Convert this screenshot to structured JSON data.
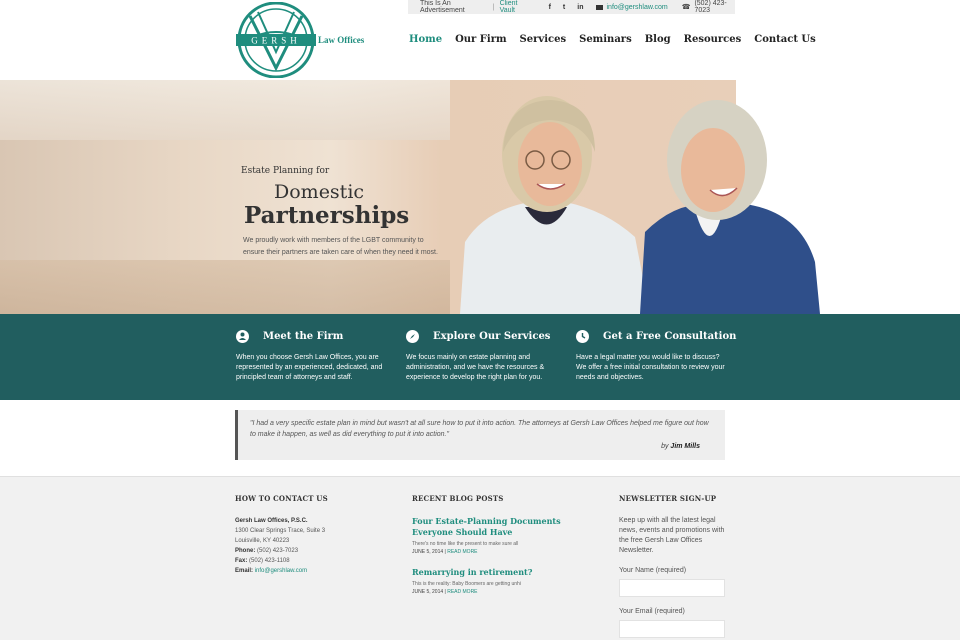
{
  "topbar": {
    "advertisement": "This Is An Advertisement",
    "separator": "|",
    "client_vault": "Client Vault",
    "social": [
      "f",
      "t",
      "in"
    ],
    "email": "info@gershlaw.com",
    "phone": "(502) 423-7023"
  },
  "logo": {
    "name": "GERSH",
    "tagline": "Law Offices"
  },
  "nav": [
    "Home",
    "Our Firm",
    "Services",
    "Seminars",
    "Blog",
    "Resources",
    "Contact Us"
  ],
  "hero": {
    "kicker": "Estate Planning for",
    "line1": "Domestic",
    "line2": "Partnerships",
    "description": "We proudly work with members of the LGBT community to ensure their partners are taken care of when they need it most."
  },
  "features": [
    {
      "title": "Meet the Firm",
      "icon": "person-icon",
      "text": "When you choose Gersh Law Offices, you are represented by an experienced, dedicated, and principled team of attorneys and staff."
    },
    {
      "title": "Explore Our Services",
      "icon": "compass-icon",
      "text": "We focus mainly on estate planning and administration, and we have the resources & experience to develop the right plan for you."
    },
    {
      "title": "Get a Free Consultation",
      "icon": "clock-icon",
      "text": "Have a legal matter you would like to discuss? We offer a free initial consultation to review your needs and objectives."
    }
  ],
  "testimonial": {
    "quote": "\"I had a very specific estate plan in mind but wasn't at all sure how to put it into action. The attorneys at Gersh Law Offices helped me figure out how to make it happen, as well as did everything to put it into action.\"",
    "by_prefix": "by",
    "author": "Jim Mills"
  },
  "footer": {
    "contact": {
      "heading": "HOW TO CONTACT US",
      "firm": "Gersh Law Offices, P.S.C.",
      "address1": "1300 Clear Springs Trace, Suite 3",
      "address2": "Louisville, KY 40223",
      "phone_label": "Phone:",
      "phone": "(502) 423-7023",
      "fax_label": "Fax:",
      "fax": "(502) 423-1108",
      "email_label": "Email:",
      "email": "info@gershlaw.com"
    },
    "blog": {
      "heading": "RECENT BLOG POSTS",
      "posts": [
        {
          "title": "Four Estate-Planning Documents Everyone Should Have",
          "excerpt": "There's no time like the present to make sure all",
          "date": "JUNE 5, 2014",
          "sep": "|",
          "more": "READ MORE"
        },
        {
          "title": "Remarrying in retirement?",
          "excerpt": "This is the reality: Baby Boomers are getting unhi",
          "date": "JUNE 5, 2014",
          "sep": "|",
          "more": "READ MORE"
        }
      ]
    },
    "newsletter": {
      "heading": "NEWSLETTER SIGN-UP",
      "text": "Keep up with all the latest legal news, events and promotions with the free Gersh Law Offices Newsletter.",
      "name_label": "Your Name (required)",
      "email_label": "Your Email (required)"
    }
  },
  "colors": {
    "teal": "#1f8d7e",
    "band": "#215e5f"
  }
}
